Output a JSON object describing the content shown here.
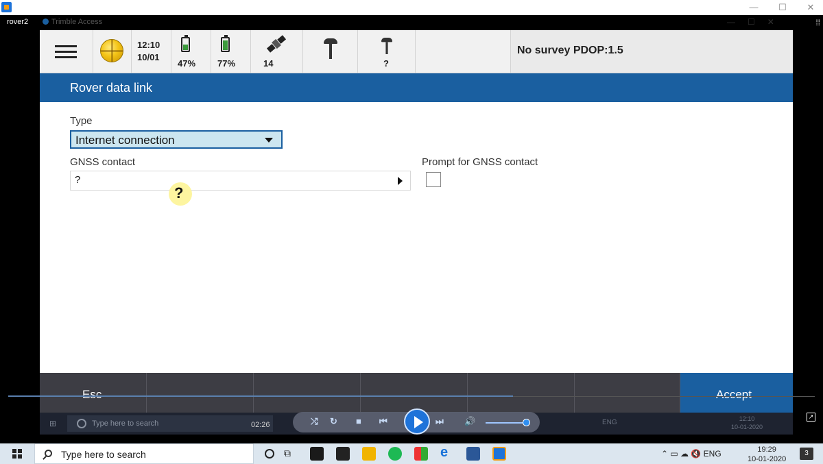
{
  "outer_window": {
    "controls": {
      "minimize": "—",
      "maximize": "☐",
      "close": "✕"
    }
  },
  "capture_window": {
    "label": "rover2",
    "app_title": "Trimble Access"
  },
  "status_bar": {
    "time": "12:10",
    "date": "10/01",
    "battery1_pct": "47%",
    "battery1_level": 0.47,
    "battery2_pct": "77%",
    "battery2_level": 0.77,
    "satellites": "14",
    "receiver2_value": "?",
    "survey_status": "No survey  PDOP:1.5"
  },
  "page": {
    "title": "Rover data link"
  },
  "form": {
    "type_label": "Type",
    "type_value": "Internet connection",
    "gnss_label": "GNSS contact",
    "gnss_value": "?",
    "prompt_label": "Prompt for GNSS contact",
    "prompt_checked": false
  },
  "footer": {
    "esc_label": "Esc",
    "accept_label": "Accept"
  },
  "player": {
    "elapsed": "02:26",
    "progress": 0.63
  },
  "inner_taskbar": {
    "search_placeholder": "Type here to search",
    "tray": "ENG",
    "time": "12:10",
    "date": "10-01-2020"
  },
  "taskbar": {
    "search_placeholder": "Type here to search",
    "language": "ENG",
    "time": "19:29",
    "date": "10-01-2020",
    "notification_count": "3"
  }
}
